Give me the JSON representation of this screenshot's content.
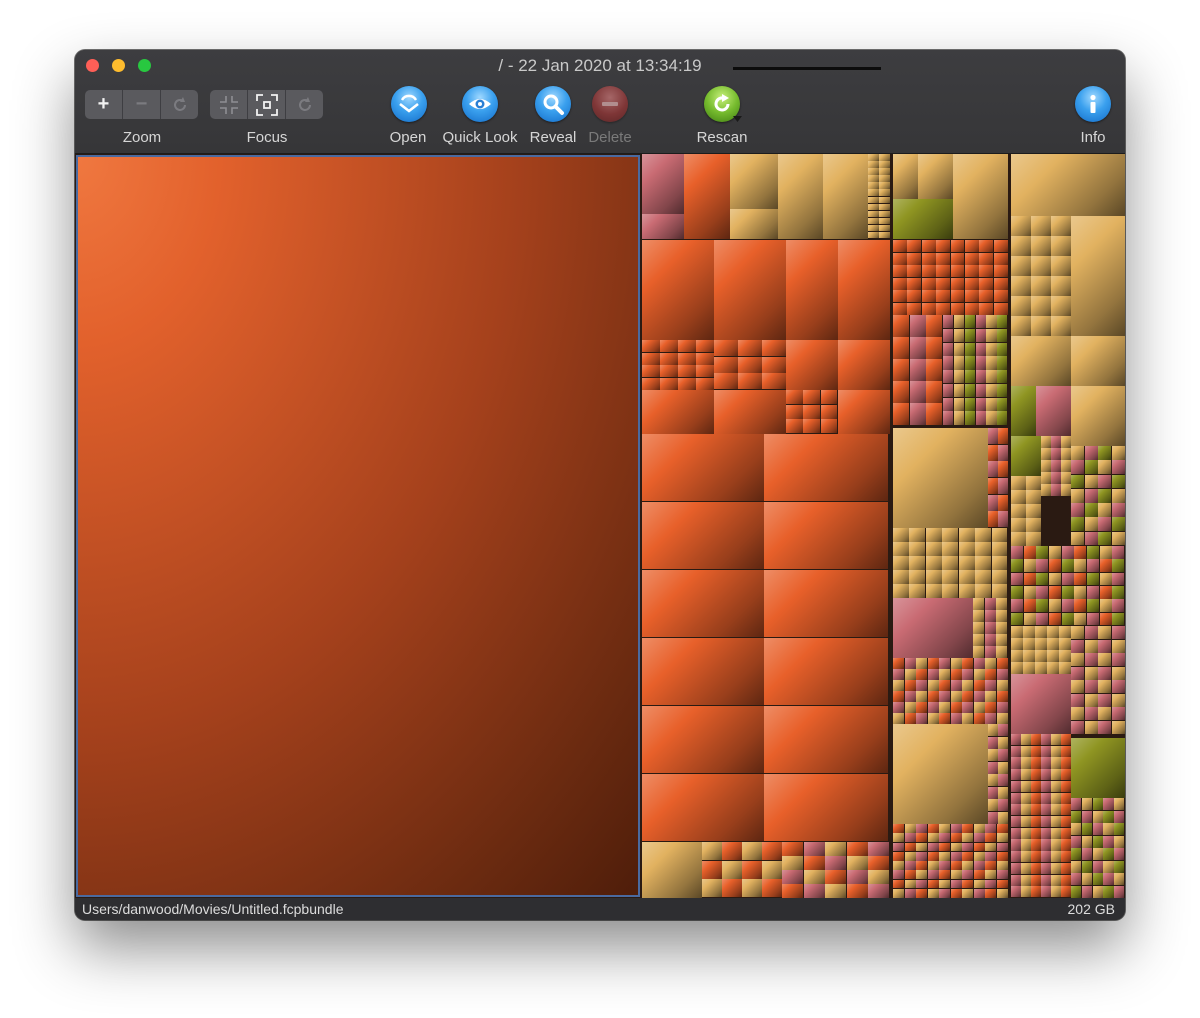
{
  "window": {
    "title": "/ - 22 Jan 2020 at 13:34:19"
  },
  "toolbar": {
    "zoom": {
      "label": "Zoom",
      "in_symbol": "+",
      "out_symbol": "−",
      "reset_icon": "rotate-icon"
    },
    "focus": {
      "label": "Focus",
      "in_icon": "focus-in-icon",
      "out_icon": "focus-out-icon",
      "reset_icon": "rotate-icon"
    },
    "open": {
      "label": "Open",
      "icon": "open-icon"
    },
    "quick_look": {
      "label": "Quick Look",
      "icon": "eye-icon"
    },
    "reveal": {
      "label": "Reveal",
      "icon": "magnifier-icon"
    },
    "delete": {
      "label": "Delete",
      "icon": "minus-circle-icon",
      "enabled": false
    },
    "rescan": {
      "label": "Rescan",
      "icon": "refresh-icon"
    },
    "info": {
      "label": "Info",
      "icon": "info-icon"
    }
  },
  "status": {
    "path": "Users/danwood/Movies/Untitled.fcpbundle",
    "size": "202 GB"
  },
  "colors": {
    "orange": "#e8602a",
    "gold": "#e2b260",
    "olive": "#8f9522",
    "rose": "#c96b73",
    "selection": "#4a6aa0"
  }
}
